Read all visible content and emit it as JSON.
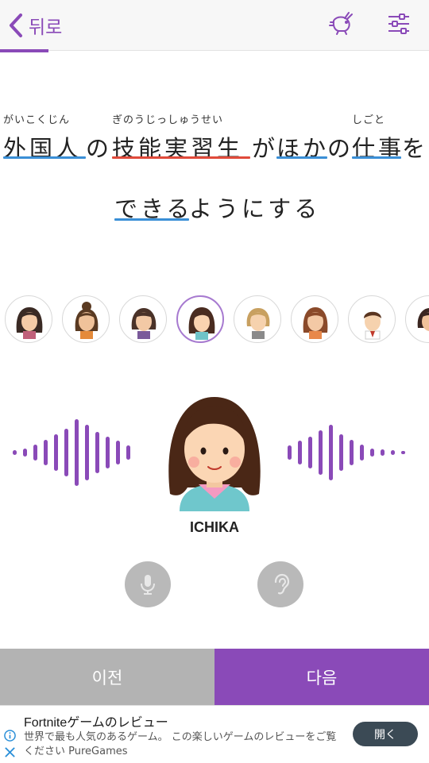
{
  "header": {
    "back_label": "뒤로",
    "icons": [
      "chevron-left-icon",
      "rabbit-speed-icon",
      "settings-sliders-icon"
    ],
    "progress_fraction": 0.11,
    "accent_color": "#8a4ab8"
  },
  "sentence": {
    "words": [
      {
        "ruby": "がいこくじん",
        "text": "外国人",
        "underline": "blue"
      },
      {
        "ruby": "",
        "text": "の",
        "underline": ""
      },
      {
        "ruby": "ぎのうじっしゅうせい",
        "text": "技能実習生",
        "underline": "red"
      },
      {
        "ruby": "",
        "text": "が",
        "underline": ""
      },
      {
        "ruby": "",
        "text": "ほか",
        "underline": "blue"
      },
      {
        "ruby": "",
        "text": "の",
        "underline": ""
      },
      {
        "ruby": "しごと",
        "text": "仕事",
        "underline": "blue"
      },
      {
        "ruby": "",
        "text": "を",
        "underline": ""
      },
      {
        "ruby": "",
        "text": "できる",
        "underline": "blue"
      },
      {
        "ruby": "",
        "text": "ようにする",
        "underline": ""
      }
    ]
  },
  "avatars": {
    "selected_index": 3,
    "count_visible": 8
  },
  "character": {
    "name": "ICHIKA"
  },
  "controls": {
    "icons": [
      "microphone-icon",
      "ear-icon"
    ]
  },
  "nav": {
    "prev_label": "이전",
    "next_label": "다음"
  },
  "ad": {
    "title": "Fortniteゲームのレビュー",
    "body": "世界で最も人気のあるゲーム。 この楽しいゲームのレビューをご覧ください PureGames",
    "button_label": "開く",
    "icons": [
      "info-icon",
      "close-icon"
    ]
  }
}
